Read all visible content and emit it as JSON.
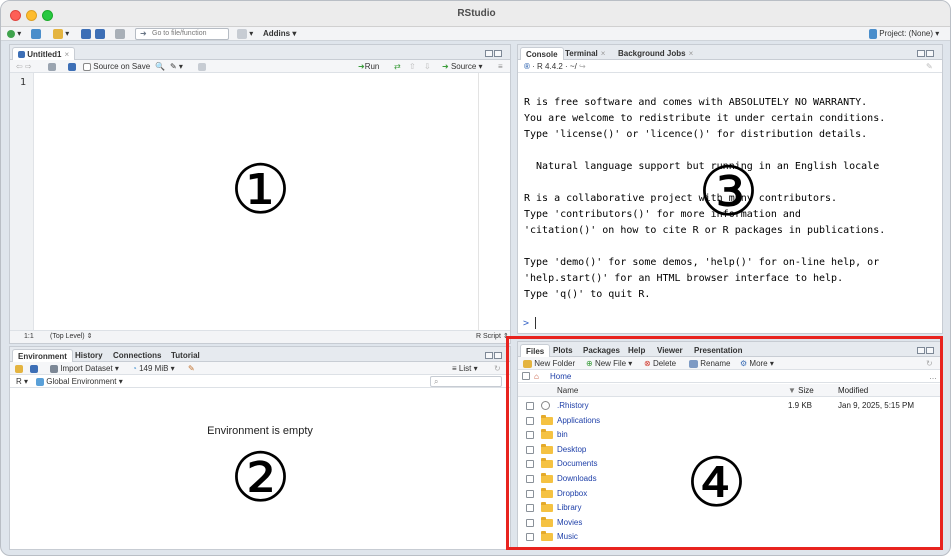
{
  "window": {
    "title": "RStudio",
    "project_label": "Project: (None)"
  },
  "toolbar": {
    "goto_placeholder": "Go to file/function",
    "addins_label": "Addins"
  },
  "source_pane": {
    "tab_label": "Untitled1",
    "source_on_save": "Source on Save",
    "run_label": "Run",
    "source_label": "Source",
    "line_number": "1",
    "status_position": "1:1",
    "status_scope": "(Top Level)",
    "status_type": "R Script",
    "marker": "①"
  },
  "env_pane": {
    "tabs": [
      "Environment",
      "History",
      "Connections",
      "Tutorial"
    ],
    "import_label": "Import Dataset",
    "memory_label": "149 MiB",
    "list_label": "List",
    "lang_label": "R",
    "scope_label": "Global Environment",
    "empty_message": "Environment is empty",
    "marker": "②"
  },
  "console_pane": {
    "tabs": [
      "Console",
      "Terminal",
      "Background Jobs"
    ],
    "version_label": "R 4.4.2 · ~/",
    "text": "R is free software and comes with ABSOLUTELY NO WARRANTY.\nYou are welcome to redistribute it under certain conditions.\nType 'license()' or 'licence()' for distribution details.\n\n  Natural language support but running in an English locale\n\nR is a collaborative project with many contributors.\nType 'contributors()' for more information and\n'citation()' on how to cite R or R packages in publications.\n\nType 'demo()' for some demos, 'help()' for on-line help, or\n'help.start()' for an HTML browser interface to help.\nType 'q()' to quit R.",
    "prompt": ">",
    "marker": "③"
  },
  "files_pane": {
    "tabs": [
      "Files",
      "Plots",
      "Packages",
      "Help",
      "Viewer",
      "Presentation"
    ],
    "actions": {
      "new_folder": "New Folder",
      "new_file": "New File",
      "delete": "Delete",
      "rename": "Rename",
      "more": "More"
    },
    "breadcrumb": "Home",
    "columns": {
      "name": "Name",
      "size": "Size",
      "modified": "Modified"
    },
    "rows": [
      {
        "name": ".Rhistory",
        "size": "1.9 KB",
        "modified": "Jan 9, 2025, 5:15 PM"
      },
      {
        "name": "Applications",
        "size": "",
        "modified": ""
      },
      {
        "name": "bin",
        "size": "",
        "modified": ""
      },
      {
        "name": "Desktop",
        "size": "",
        "modified": ""
      },
      {
        "name": "Documents",
        "size": "",
        "modified": ""
      },
      {
        "name": "Downloads",
        "size": "",
        "modified": ""
      },
      {
        "name": "Dropbox",
        "size": "",
        "modified": ""
      },
      {
        "name": "Library",
        "size": "",
        "modified": ""
      },
      {
        "name": "Movies",
        "size": "",
        "modified": ""
      },
      {
        "name": "Music",
        "size": "",
        "modified": ""
      }
    ],
    "marker": "④",
    "highlight_color": "#e8231f"
  }
}
